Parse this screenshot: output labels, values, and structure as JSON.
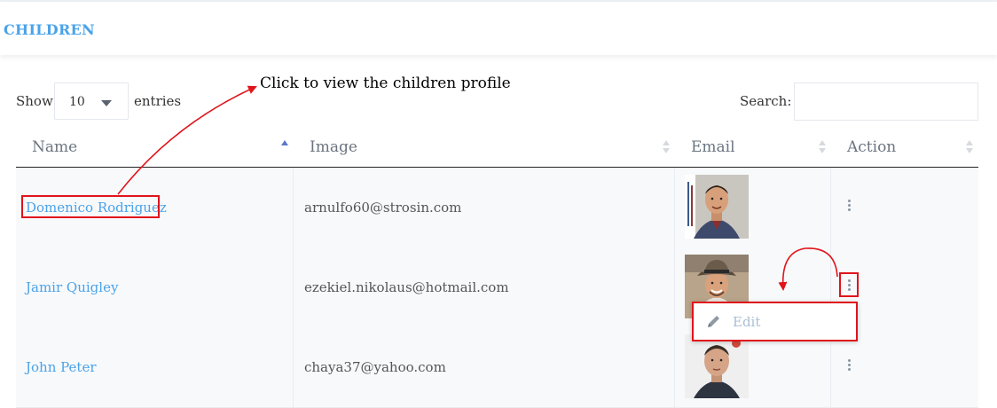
{
  "header": {
    "title": "CHILDREN"
  },
  "annotation": "Click to view the children profile",
  "controls": {
    "show_label": "Show",
    "page_length": "10",
    "entries_label": "entries",
    "search_label": "Search:",
    "search_value": ""
  },
  "table": {
    "columns": [
      "Name",
      "Image",
      "Email",
      "Action"
    ],
    "rows": [
      {
        "name": "Domenico Rodriguez",
        "email": "arnulfo60@strosin.com"
      },
      {
        "name": "Jamir Quigley",
        "email": "ezekiel.nikolaus@hotmail.com"
      },
      {
        "name": "John Peter",
        "email": "chaya37@yahoo.com"
      }
    ]
  },
  "action_menu": {
    "edit_label": "Edit"
  },
  "colors": {
    "accent": "#4aa3e8",
    "highlight": "#e0141b"
  }
}
